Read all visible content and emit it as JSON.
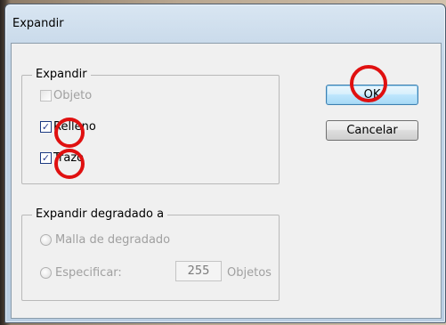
{
  "dialog": {
    "title": "Expandir"
  },
  "expand_group": {
    "legend": "Expandir",
    "objeto_label": "Objeto",
    "relleno_label": "Relleno",
    "trazo_label": "Trazo",
    "objeto_checked": false,
    "relleno_checked": true,
    "trazo_checked": true
  },
  "gradient_group": {
    "legend": "Expandir degradado a",
    "malla_label": "Malla de degradado",
    "especificar_label": "Especificar:",
    "especificar_value": "255",
    "objetos_label": "Objetos"
  },
  "buttons": {
    "ok_label": "OK",
    "cancel_label": "Cancelar"
  },
  "annotations": {
    "highlight_color": "#e01010"
  }
}
